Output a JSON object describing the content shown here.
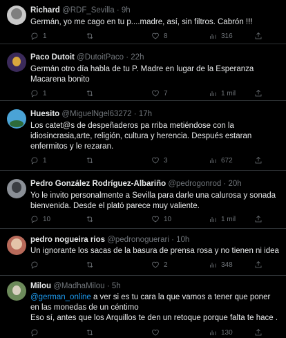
{
  "tweets": [
    {
      "name": "Richard",
      "handle": "@RDF_Sevilla",
      "time": "9h",
      "text": "Germán, yo me cago en tu p....madre, así, sin filtros. Cabrón !!!",
      "replies": "1",
      "retweets": "",
      "likes": "8",
      "views": "316",
      "avatar_colors": [
        "#c9c9c9",
        "#7f7f7f"
      ]
    },
    {
      "name": "Paco Dutoit",
      "handle": "@DutoitPaco",
      "time": "22h",
      "text": "Germán otro día habla de tu P. Madre en lugar de la Esperanza Macarena bonito",
      "replies": "1",
      "retweets": "",
      "likes": "7",
      "views": "1 mil",
      "avatar_colors": [
        "#3b2a5a",
        "#d9a73d"
      ]
    },
    {
      "name": "Huesito",
      "handle": "@MiguelNgel63272",
      "time": "17h",
      "text": "Los catet@s de despeñaderos pa rriba metiéndose con la idiosincrasia,arte, religión, cultura y herencia. Después estaran enfermitos y le rezaran.",
      "replies": "1",
      "retweets": "",
      "likes": "3",
      "views": "672",
      "avatar_colors": [
        "#4aa3d6",
        "#2d6b3a"
      ]
    },
    {
      "name": "Pedro González Rodríguez-Albariño",
      "handle": "@pedrogonrod",
      "time": "20h",
      "text": "Yo le invito personalmente a Sevilla para darle una calurosa y sonada bienvenida. Desde el plató parece muy valiente.",
      "replies": "10",
      "retweets": "",
      "likes": "10",
      "views": "1 mil",
      "avatar_colors": [
        "#8a8f96",
        "#3a3d42"
      ]
    },
    {
      "name": "pedro nogueira rios",
      "handle": "@pedronoguerari",
      "time": "10h",
      "text": "Un ignorante los sacas de la basura de prensa rosa y no tienen ni idea",
      "replies": "",
      "retweets": "",
      "likes": "2",
      "views": "348",
      "avatar_colors": [
        "#b86a5a",
        "#e3c3a8"
      ]
    },
    {
      "name": "Milou",
      "handle": "@MadhaMilou",
      "time": "5h",
      "mention": "@german_online",
      "text": " a ver si es tu cara la que vamos a tener que poner en las monedas de un céntimo",
      "text2": "Eso sí, antes que los Arquillos te den un retoque porque falta te hace .",
      "replies": "",
      "retweets": "",
      "likes": "",
      "views": "130",
      "avatar_colors": [
        "#6c8a5a",
        "#d8d0c0"
      ]
    }
  ],
  "separator": "·"
}
